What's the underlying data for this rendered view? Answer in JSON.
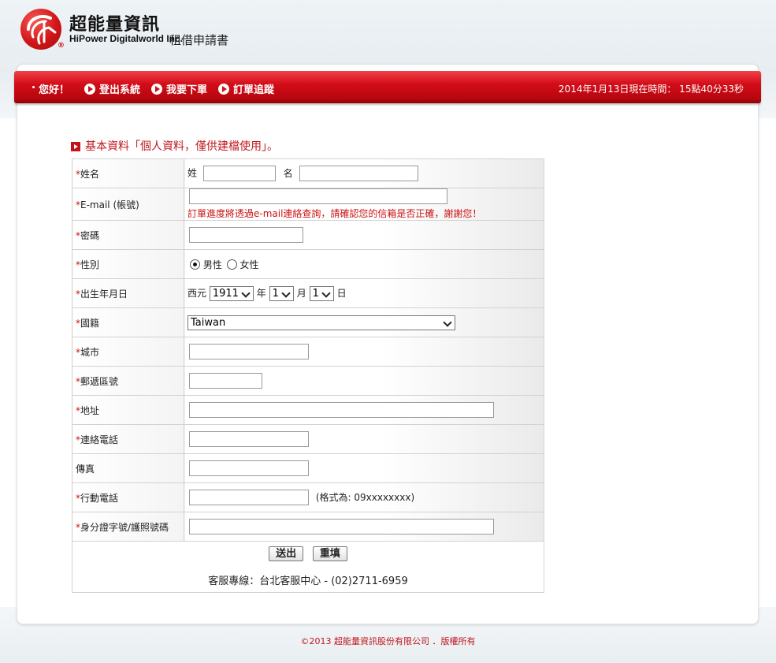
{
  "header": {
    "company_cn": "超能量資訊",
    "company_en": "HiPower Digitalworld Inc.",
    "doc_title": "租借申請書",
    "logo_icon": "hipower-logo-icon",
    "reg_mark": "®"
  },
  "nav": {
    "greeting": "您好！",
    "items": [
      {
        "label": "登出系統",
        "icon": "play-icon"
      },
      {
        "label": "我要下單",
        "icon": "play-icon"
      },
      {
        "label": "訂單追蹤",
        "icon": "play-icon"
      }
    ],
    "clock": "2014年1月13日現在時間： 15點40分33秒"
  },
  "section": {
    "title": "基本資料「個人資料，僅供建檔使用」。"
  },
  "form": {
    "required_mark": "*",
    "name": {
      "label": "姓名",
      "last_label": "姓",
      "first_label": "名",
      "last_value": "",
      "first_value": ""
    },
    "email": {
      "label": "E-mail (帳號)",
      "value": "",
      "note": "訂單進度將透過e-mail連絡查詢，請確認您的信箱是否正確，謝謝您！"
    },
    "password": {
      "label": "密碼",
      "value": ""
    },
    "gender": {
      "label": "性別",
      "options": [
        "男性",
        "女性"
      ],
      "selected": "男性"
    },
    "birth": {
      "label": "出生年月日",
      "era": "西元",
      "year": "1911",
      "year_unit": "年",
      "month": "1",
      "month_unit": "月",
      "day": "1",
      "day_unit": "日"
    },
    "nationality": {
      "label": "國籍",
      "value": "Taiwan"
    },
    "city": {
      "label": "城市",
      "value": ""
    },
    "zip": {
      "label": "郵遞區號",
      "value": ""
    },
    "address": {
      "label": "地址",
      "value": ""
    },
    "phone": {
      "label": "連絡電話",
      "value": ""
    },
    "fax": {
      "label": "傳真",
      "value": ""
    },
    "mobile": {
      "label": "行動電話",
      "value": "",
      "hint": "(格式為: 09xxxxxxxx)"
    },
    "id_number": {
      "label": "身分證字號/護照號碼",
      "value": ""
    },
    "submit_label": "送出",
    "reset_label": "重填",
    "hotline": "客服專線：台北客服中心 -  (02)2711-6959"
  },
  "footer": {
    "copyright": "©2013 超能量資訊股份有限公司 ．版權所有"
  },
  "colors": {
    "brand_red": "#cc1016",
    "nav_red_top": "#f2414a",
    "nav_red_bottom": "#8e0309",
    "note_red": "#cc1111"
  }
}
